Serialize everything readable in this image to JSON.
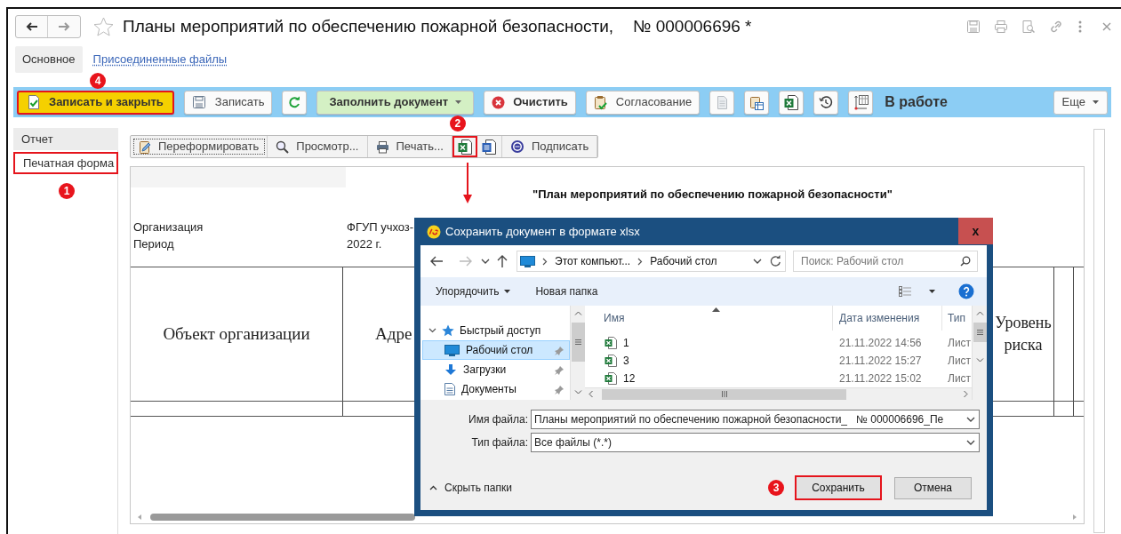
{
  "window": {
    "title": "Планы мероприятий по обеспечению пожарной безопасности,",
    "number": "№ 000006696 *",
    "favorite": false
  },
  "tabs": [
    {
      "label": "Основное",
      "selected": true
    },
    {
      "label": "Присоединенные файлы",
      "selected": false
    }
  ],
  "toolbar": {
    "buttons": [
      {
        "kind": "primary",
        "label": "Записать и закрыть",
        "highlighted": true,
        "marker": "4"
      },
      {
        "kind": "plain",
        "label": "Записать",
        "highlighted": false
      },
      {
        "kind": "icon",
        "highlighted": false
      },
      {
        "kind": "menu",
        "label": "Заполнить документ",
        "highlighted": false
      },
      {
        "kind": "strong",
        "label": "Очистить",
        "highlighted": false
      },
      {
        "kind": "plain",
        "label": "Согласование",
        "highlighted": false
      },
      {
        "kind": "icon",
        "highlighted": false
      },
      {
        "kind": "icon",
        "highlighted": false
      },
      {
        "kind": "icon",
        "highlighted": false
      },
      {
        "kind": "icon",
        "highlighted": false
      },
      {
        "kind": "icon",
        "highlighted": false
      }
    ],
    "status": "В работе",
    "more": "Еще"
  },
  "side_panel": [
    {
      "label": "Отчет",
      "selected": true,
      "highlighted": false
    },
    {
      "label": "Печатная форма",
      "selected": false,
      "highlighted": true,
      "marker": "1"
    }
  ],
  "report_toolbar": [
    {
      "kind": "text",
      "label": "Переформировать",
      "highlighted": false,
      "focused": true
    },
    {
      "kind": "text",
      "label": "Просмотр...",
      "highlighted": false,
      "focused": false
    },
    {
      "kind": "text",
      "label": "Печать...",
      "highlighted": false,
      "focused": false
    },
    {
      "kind": "icon",
      "highlighted": true,
      "marker": "2",
      "focused": false
    },
    {
      "kind": "icon",
      "highlighted": false,
      "focused": false
    },
    {
      "kind": "text",
      "label": "Подписать",
      "highlighted": false,
      "focused": false
    }
  ],
  "sheet": {
    "title": "\"План мероприятий по обеспечению пожарной безопасности\"",
    "fields": [
      {
        "label": "Организация",
        "value": "ФГУП учхоз-"
      },
      {
        "label": "Период",
        "value": "2022 г."
      }
    ],
    "columns": [
      "Объект организации",
      "Адре",
      "Уровень риска"
    ]
  },
  "dialog": {
    "title": "Сохранить документ в формате xlsx",
    "close": "x",
    "path": [
      "Этот компьют...",
      "Рабочий стол"
    ],
    "search_placeholder": "Поиск: Рабочий стол",
    "commands": [
      {
        "label": "Упорядочить",
        "dropdown": true
      },
      {
        "label": "Новая папка",
        "dropdown": false
      }
    ],
    "nav": [
      {
        "label": "Быстрый доступ",
        "expanded": true,
        "selected": false,
        "children": [
          {
            "label": "Рабочий стол",
            "selected": true
          },
          {
            "label": "Загрузки",
            "selected": false
          },
          {
            "label": "Документы",
            "selected": false
          }
        ]
      }
    ],
    "columns": [
      "Имя",
      "Дата изменения",
      "Тип"
    ],
    "files": [
      {
        "name": "1",
        "modified": "21.11.2022 14:56",
        "type": "Лист"
      },
      {
        "name": "3",
        "modified": "21.11.2022 15:27",
        "type": "Лист"
      },
      {
        "name": "12",
        "modified": "21.11.2022 15:02",
        "type": "Лист"
      }
    ],
    "file_name": {
      "label": "Имя файла:",
      "value": "Планы мероприятий по обеспечению пожарной безопасности_   № 000006696_Пе"
    },
    "file_type": {
      "label": "Тип файла:",
      "value": "Все файлы (*.*)"
    },
    "toggle": "Скрыть папки",
    "buttons": [
      {
        "label": "Сохранить",
        "highlighted": true,
        "marker": "3"
      },
      {
        "label": "Отмена",
        "highlighted": false
      }
    ]
  }
}
